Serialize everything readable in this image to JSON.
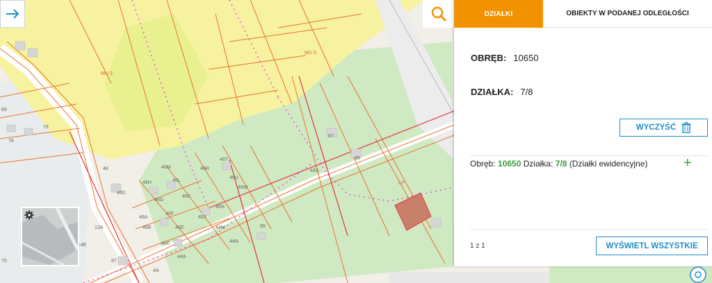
{
  "tabs": {
    "active_label": "DZIAŁKI",
    "inactive_label": "OBIEKTY W PODANEJ ODLEGŁOŚCI"
  },
  "details": {
    "obreb_label": "OBRĘB:",
    "obreb_value": "10650",
    "dzialka_label": "DZIAŁKA:",
    "dzialka_value": "7/8"
  },
  "clear_button_label": "WYCZYŚĆ",
  "result": {
    "obreb_prefix": "Obręb:",
    "obreb_value": "10650",
    "dzialka_prefix": "Działka:",
    "dzialka_value": "7/8",
    "type_text": "(Działki ewidencyjne)"
  },
  "pager_text": "1 z 1",
  "show_all_label": "WYŚWIETL WSZYSTKIE",
  "map": {
    "zone_labels": [
      "MU 3",
      "MU 3",
      "UT"
    ],
    "parcel_labels": [
      "46M",
      "46N",
      "46R",
      "46T",
      "46U",
      "46W",
      "46H",
      "46L",
      "46K",
      "46G",
      "46F",
      "46E",
      "46J",
      "46D",
      "46C",
      "46B",
      "46A",
      "46S",
      "44M",
      "44N",
      "44A",
      "4A",
      "67",
      "85",
      "87",
      "88",
      "89",
      "79",
      "78",
      "48",
      "70",
      "13A",
      "14E"
    ]
  },
  "icons": [
    "search-icon",
    "arrow-right-icon",
    "gear-icon",
    "trash-icon",
    "plus-icon"
  ],
  "colors": {
    "accent": "#f39200",
    "link": "#1e8fc6",
    "green": "#3d9a3a",
    "zone_yellow": "#f7f2a0",
    "greenery": "#cdeac0",
    "parcel_line": "#e9732e",
    "selected_parcel": "#c9806b",
    "pink_line": "#e23fd6"
  }
}
